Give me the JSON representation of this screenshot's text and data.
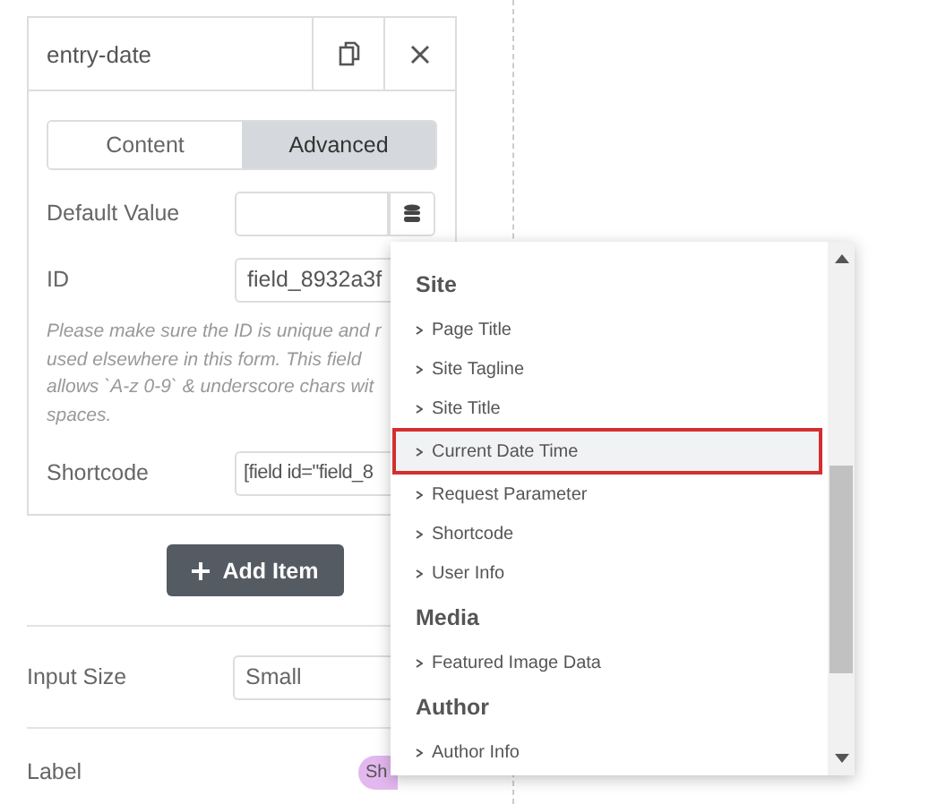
{
  "panel": {
    "title": "entry-date",
    "tabs": [
      {
        "label": "Content",
        "selected": false
      },
      {
        "label": "Advanced",
        "selected": true
      }
    ],
    "default_value": {
      "label": "Default Value"
    },
    "id": {
      "label": "ID",
      "value": "field_8932a3f"
    },
    "help_lines": [
      "Please make sure the ID is unique and r",
      "used elsewhere in this form. This field",
      "allows `A-z 0-9` & underscore chars wit",
      "spaces."
    ],
    "shortcode": {
      "label": "Shortcode",
      "value": "[field id=\"field_8"
    }
  },
  "add_button": "Add Item",
  "input_size": {
    "label": "Input Size",
    "value": "Small"
  },
  "label_row": {
    "label": "Label",
    "toggle_text": "Sh",
    "on": true
  },
  "dropdown": {
    "groups": [
      {
        "title": "Site",
        "items": [
          {
            "label": "Page Title",
            "selected": false
          },
          {
            "label": "Site Tagline",
            "selected": false
          },
          {
            "label": "Site Title",
            "selected": false
          },
          {
            "label": "Current Date Time",
            "selected": true
          },
          {
            "label": "Request Parameter",
            "selected": false
          },
          {
            "label": "Shortcode",
            "selected": false
          },
          {
            "label": "User Info",
            "selected": false
          }
        ]
      },
      {
        "title": "Media",
        "items": [
          {
            "label": "Featured Image Data",
            "selected": false
          }
        ]
      },
      {
        "title": "Author",
        "items": [
          {
            "label": "Author Info",
            "selected": false
          }
        ]
      }
    ]
  }
}
